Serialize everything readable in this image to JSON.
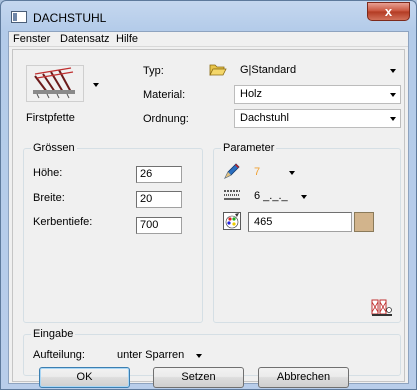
{
  "window": {
    "title": "DACHSTUHL",
    "close_label": "x"
  },
  "menu": {
    "items": [
      "Fenster",
      "Datensatz",
      "Hilfe"
    ]
  },
  "element": {
    "label": "Firstpfette",
    "typ_label": "Typ:",
    "typ_value": "G|Standard",
    "material_label": "Material:",
    "material_value": "Holz",
    "ordnung_label": "Ordnung:",
    "ordnung_value": "Dachstuhl"
  },
  "groessen": {
    "title": "Grössen",
    "hoehe_label": "Höhe:",
    "hoehe_value": "26",
    "breite_label": "Breite:",
    "breite_value": "20",
    "kerbentiefe_label": "Kerbentiefe:",
    "kerbentiefe_value": "700"
  },
  "parameter": {
    "title": "Parameter",
    "pen_value": "7",
    "linetype_value": "6 _._._",
    "color_value": "465",
    "pen_color": "#f0a030",
    "swatch_color": "#d2b48c"
  },
  "eingabe": {
    "title": "Eingabe",
    "aufteilung_label": "Aufteilung:",
    "aufteilung_value": "unter Sparren"
  },
  "buttons": {
    "ok": "OK",
    "setzen": "Setzen",
    "abbrechen": "Abbrechen"
  }
}
